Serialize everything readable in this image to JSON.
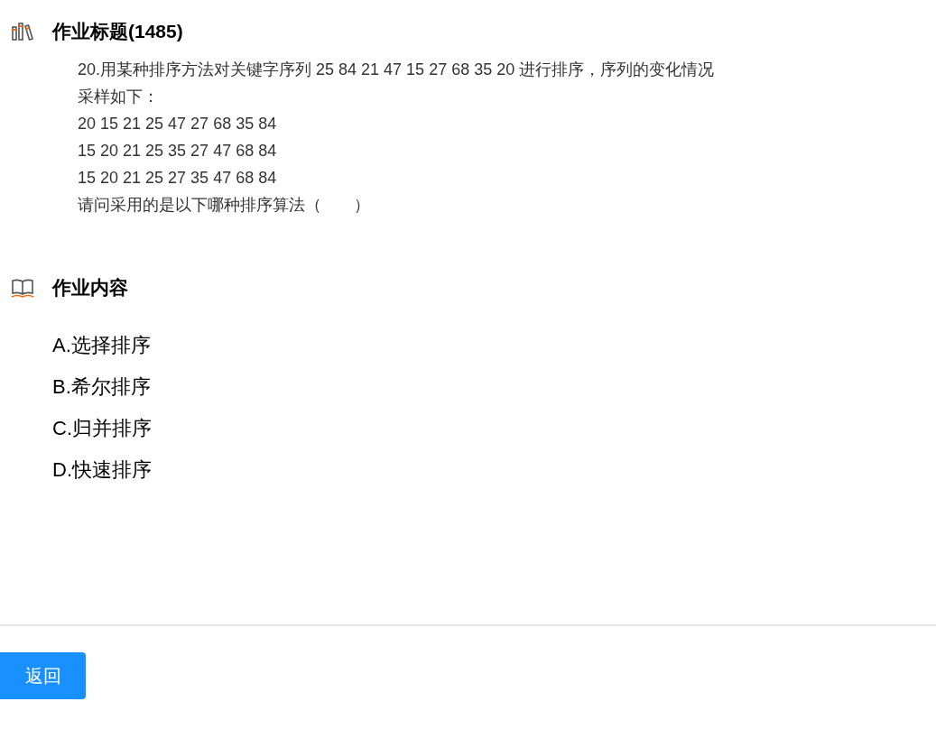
{
  "sections": [
    {
      "kind": "title",
      "heading": "作业标题(1485)",
      "lines": [
        "20.用某种排序方法对关键字序列 25 84 21 47 15 27 68 35 20 进行排序，序列的变化情况",
        "采样如下：",
        "20 15 21 25 47 27 68 35 84",
        "15 20 21 25 35 27 47 68 84",
        "15 20 21 25 27 35 47 68 84",
        "请问采用的是以下哪种排序算法（　　）"
      ]
    },
    {
      "kind": "content",
      "heading": "作业内容",
      "options": [
        "A.选择排序",
        "B.希尔排序",
        "C.归并排序",
        "D.快速排序"
      ]
    }
  ],
  "back_button": "返回"
}
